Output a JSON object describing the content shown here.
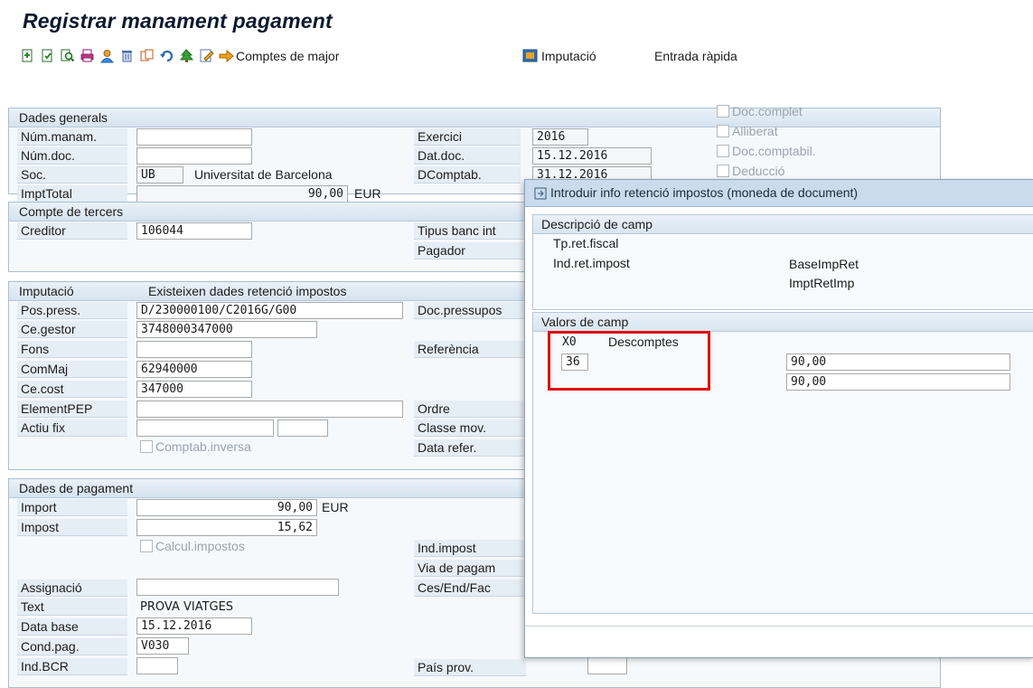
{
  "window": {
    "title": "Registrar manament pagament"
  },
  "toolbar": {
    "icons": [
      "new-document-icon",
      "copy-document-icon",
      "find-icon",
      "print-icon",
      "user-icon",
      "delete-icon",
      "duplicate-icon",
      "undo-icon",
      "tree-icon",
      "edit-icon",
      "arrow-icon"
    ],
    "comptes_label": "Comptes de major",
    "imputacio_label": "Imputació",
    "entrada_label": "Entrada ràpida"
  },
  "dades_generals": {
    "header": "Dades generals",
    "num_manam_label": "Núm.manam.",
    "num_manam_value": "",
    "num_doc_label": "Núm.doc.",
    "num_doc_value": "",
    "soc_label": "Soc.",
    "soc_value": "UB",
    "soc_name": "Universitat de Barcelona",
    "impt_total_label": "ImptTotal",
    "impt_total_value": "90,00",
    "impt_total_currency": "EUR",
    "exercici_label": "Exercici",
    "exercici_value": "2016",
    "dat_doc_label": "Dat.doc.",
    "dat_doc_value": "15.12.2016",
    "dcomptab_label": "DComptab.",
    "dcomptab_value": "31.12.2016",
    "chk_doc_complet": "Doc.complet",
    "chk_alliberat": "Alliberat",
    "chk_doc_comptabil": "Doc.comptabil.",
    "chk_deduccio": "Deducció"
  },
  "compte_tercers": {
    "header": "Compte de tercers",
    "creditor_label": "Creditor",
    "creditor_value": "106044",
    "tipus_banc_label": "Tipus banc int",
    "pagador_label": "Pagador"
  },
  "imputacio": {
    "header": "Imputació",
    "header_note": "Existeixen dades retenció impostos",
    "pos_press_label": "Pos.press.",
    "pos_press_value": "D/230000100/C2016G/G00",
    "doc_pressup_label": "Doc.pressupos",
    "ce_gestor_label": "Ce.gestor",
    "ce_gestor_value": "3748000347000",
    "fons_label": "Fons",
    "fons_value": "",
    "referencia_label": "Referència",
    "commaj_label": "ComMaj",
    "commaj_value": "62940000",
    "ce_cost_label": "Ce.cost",
    "ce_cost_value": "347000",
    "elementpep_label": "ElementPEP",
    "elementpep_value": "",
    "ordre_label": "Ordre",
    "actiu_fix_label": "Actiu fix",
    "classe_mov_label": "Classe mov.",
    "comptab_inversa": "Comptab.inversa",
    "data_refer_label": "Data refer."
  },
  "dades_pagament": {
    "header": "Dades de pagament",
    "import_label": "Import",
    "import_value": "90,00",
    "import_currency": "EUR",
    "impost_label": "Impost",
    "impost_value": "15,62",
    "calcul_impostos": "Calcul.impostos",
    "ind_impost_label": "Ind.impost",
    "via_pagament_label": "Via de pagam",
    "assignacio_label": "Assignació",
    "assignacio_value": "",
    "ces_end_fac_label": "Ces/End/Fac",
    "text_label": "Text",
    "text_value": "PROVA VIATGES",
    "data_base_label": "Data base",
    "data_base_value": "15.12.2016",
    "cond_pag_label": "Cond.pag.",
    "cond_pag_value": "V030",
    "ind_bcr_label": "Ind.BCR",
    "ind_bcr_value": "",
    "pais_prov_label": "País prov."
  },
  "dialog": {
    "title": "Introduir info retenció impostos (moneda de document)",
    "desc_header": "Descripció de camp",
    "tp_ret_fiscal": "Tp.ret.fiscal",
    "ind_ret_impost": "Ind.ret.impost",
    "base_imp_ret": "BaseImpRet",
    "impt_ret_imp": "ImptRetImp",
    "valors_header": "Valors de camp",
    "tp_code": "X0",
    "tp_desc": "Descomptes",
    "ind_value": "36",
    "base_value": "90,00",
    "impt_value": "90,00"
  }
}
